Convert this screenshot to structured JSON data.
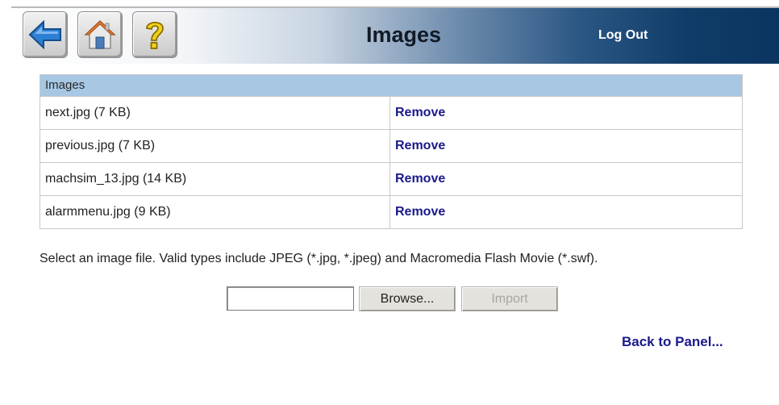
{
  "header": {
    "title": "Images",
    "logout_label": "Log Out",
    "icons": [
      "back-arrow-icon",
      "home-icon",
      "help-question-icon"
    ]
  },
  "images_table": {
    "header": "Images",
    "rows": [
      {
        "file": "next.jpg (7 KB)",
        "action": "Remove"
      },
      {
        "file": "previous.jpg (7 KB)",
        "action": "Remove"
      },
      {
        "file": "machsim_13.jpg (14 KB)",
        "action": "Remove"
      },
      {
        "file": "alarmmenu.jpg (9 KB)",
        "action": "Remove"
      }
    ]
  },
  "instructions": "Select an image file. Valid types include JPEG (*.jpg, *.jpeg) and Macromedia Flash Movie (*.swf).",
  "upload": {
    "file_value": "",
    "browse_label": "Browse...",
    "import_label": "Import"
  },
  "back_link": "Back to Panel...",
  "colors": {
    "link": "#1a1a8c",
    "table_header_bg": "#a7c7e3",
    "header_dark": "#0b3560"
  }
}
